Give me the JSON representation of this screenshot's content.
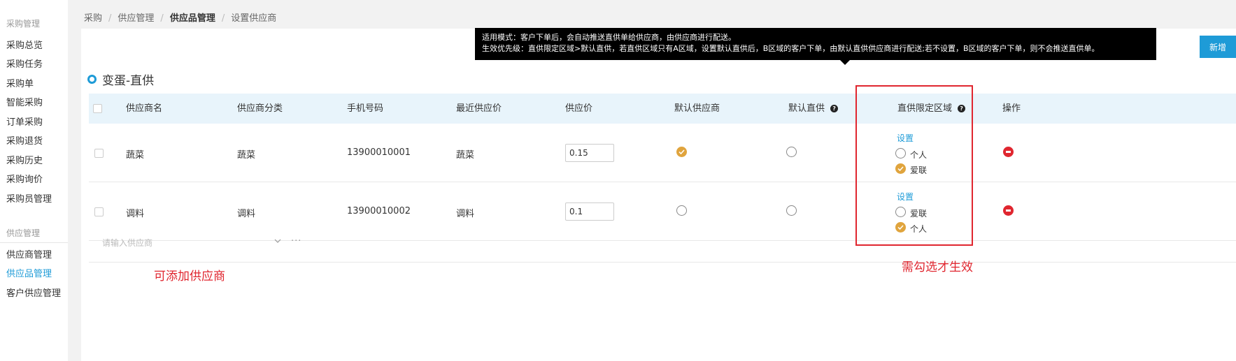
{
  "sidebar": {
    "section1": "采购管理",
    "items1": [
      "采购总览",
      "采购任务",
      "采购单",
      "智能采购",
      "订单采购",
      "采购退货",
      "采购历史",
      "采购询价",
      "采购员管理"
    ],
    "section2": "供应管理",
    "items2": [
      "供应商管理",
      "供应品管理",
      "客户供应管理"
    ],
    "active": "供应品管理"
  },
  "breadcrumb": {
    "items": [
      "采购",
      "供应管理",
      "供应品管理",
      "设置供应商"
    ],
    "separator": "/"
  },
  "toolbar": {
    "new_label": "新增"
  },
  "section": {
    "title": "变蛋-直供"
  },
  "tooltip": {
    "line1": "适用模式：客户下单后，会自动推送直供单给供应商，由供应商进行配送。",
    "line2": "生效优先级：直供限定区域>默认直供，若直供区域只有A区域，设置默认直供后，B区域的客户下单，由默认直供供应商进行配送;若不设置，B区域的客户下单，则不会推送直供单。"
  },
  "table": {
    "headers": {
      "name": "供应商名",
      "category": "供应商分类",
      "phone": "手机号码",
      "recent_price": "最近供应价",
      "price": "供应价",
      "default_supplier": "默认供应商",
      "default_direct": "默认直供",
      "region": "直供限定区域",
      "action": "操作"
    },
    "rows": [
      {
        "name": "蔬菜",
        "category": "蔬菜",
        "phone": "13900010001",
        "recent_price": "蔬菜",
        "price": "0.15",
        "default_supplier": true,
        "default_direct": false,
        "region_link": "设置",
        "regions": [
          {
            "label": "个人",
            "checked": false
          },
          {
            "label": "爱联",
            "checked": true
          }
        ]
      },
      {
        "name": "调料",
        "category": "调料",
        "phone": "13900010002",
        "recent_price": "调料",
        "price": "0.1",
        "default_supplier": false,
        "default_direct": false,
        "region_link": "设置",
        "regions": [
          {
            "label": "爱联",
            "checked": false
          },
          {
            "label": "个人",
            "checked": true
          }
        ]
      }
    ]
  },
  "add_supplier": {
    "placeholder": "请输入供应商",
    "more": "···"
  },
  "annotations": {
    "add_note": "可添加供应商",
    "check_note": "需勾选才生效"
  },
  "colors": {
    "accent": "#1e9bd7",
    "check": "#e0a43d",
    "danger": "#e0262f",
    "header_bg": "#e8f4fb"
  }
}
